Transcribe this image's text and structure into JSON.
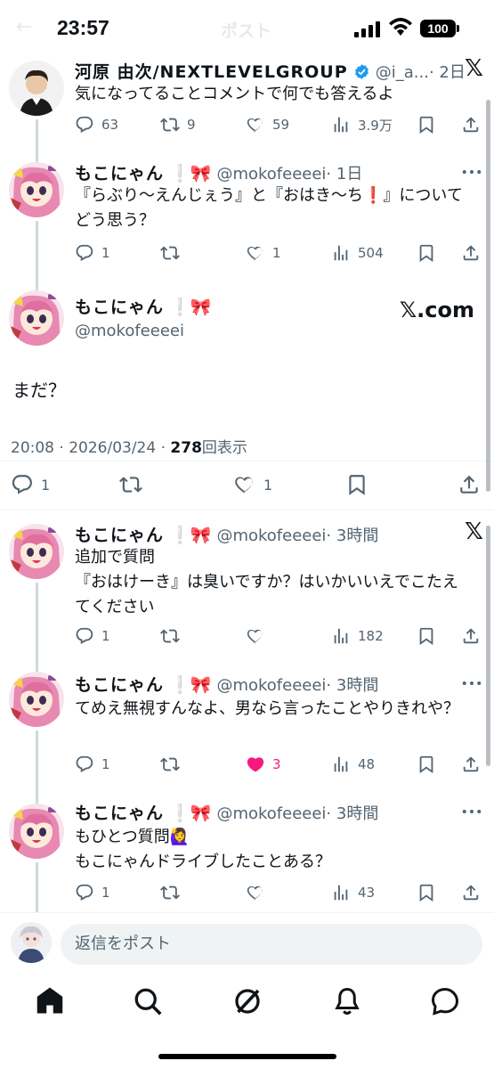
{
  "status_bar": {
    "time": "23:57",
    "battery": "100",
    "ghost_title": "ポスト",
    "ghost_back": "←"
  },
  "colors": {
    "accent": "#1d9bf0",
    "like_pink": "#f91880",
    "muted": "#536471"
  },
  "posts": [
    {
      "name": "河原 由次/NEXTLEVELGROUP",
      "verified": true,
      "handle": "@i_a...",
      "time": "· 2日",
      "text": "気になってることコメントで何でも答えるよ",
      "replies": "63",
      "reposts": "9",
      "likes": "59",
      "views": "3.9万",
      "corner": "x-logo-icon"
    },
    {
      "name": "もこにゃん",
      "emoji": "❕🎀",
      "handle": "@mokofeeeei",
      "time": "· 1日",
      "text": "『らぶり～えんじぇう』と『おはき～ち❗️』についてどう思う？",
      "replies": "1",
      "reposts": "",
      "likes": "1",
      "views": "504",
      "corner": "more-icon"
    }
  ],
  "focused": {
    "name": "もこにゃん",
    "emoji": "❕🎀",
    "handle": "@mokofeeeei",
    "watermark": "𝕏.com",
    "text": "まだ？",
    "datetime": "20:08 · 2026/03/24 · ",
    "views_count": "278",
    "views_label": "回表示",
    "replies": "1",
    "likes": "1"
  },
  "replies": [
    {
      "name": "もこにゃん",
      "emoji": "❕🎀",
      "handle": "@mokofeeeei",
      "time": "· 3時間",
      "text": "追加で質問\n『おはけーき』は臭いですか？はいかいいえでこたえてください",
      "replies": "1",
      "reposts": "",
      "likes": "",
      "views": "182",
      "liked": false,
      "corner": "x-logo-icon"
    },
    {
      "name": "もこにゃん",
      "emoji": "❕🎀",
      "handle": "@mokofeeeei",
      "time": "· 3時間",
      "text": "てめえ無視すんなよ、男なら言ったことやりきれや？",
      "replies": "1",
      "reposts": "",
      "likes": "3",
      "views": "48",
      "liked": true,
      "corner": "more-icon"
    },
    {
      "name": "もこにゃん",
      "emoji": "❕🎀",
      "handle": "@mokofeeeei",
      "time": "· 3時間",
      "text": "もひとつ質問🙋‍♀️\nもこにゃんドライブしたことある？",
      "replies": "1",
      "reposts": "",
      "likes": "",
      "views": "43",
      "liked": false,
      "corner": "more-icon"
    }
  ],
  "reply_bar": {
    "placeholder": "返信をポスト"
  },
  "tabs": [
    "home-icon",
    "search-icon",
    "grok-icon",
    "notifications-icon",
    "messages-icon"
  ]
}
